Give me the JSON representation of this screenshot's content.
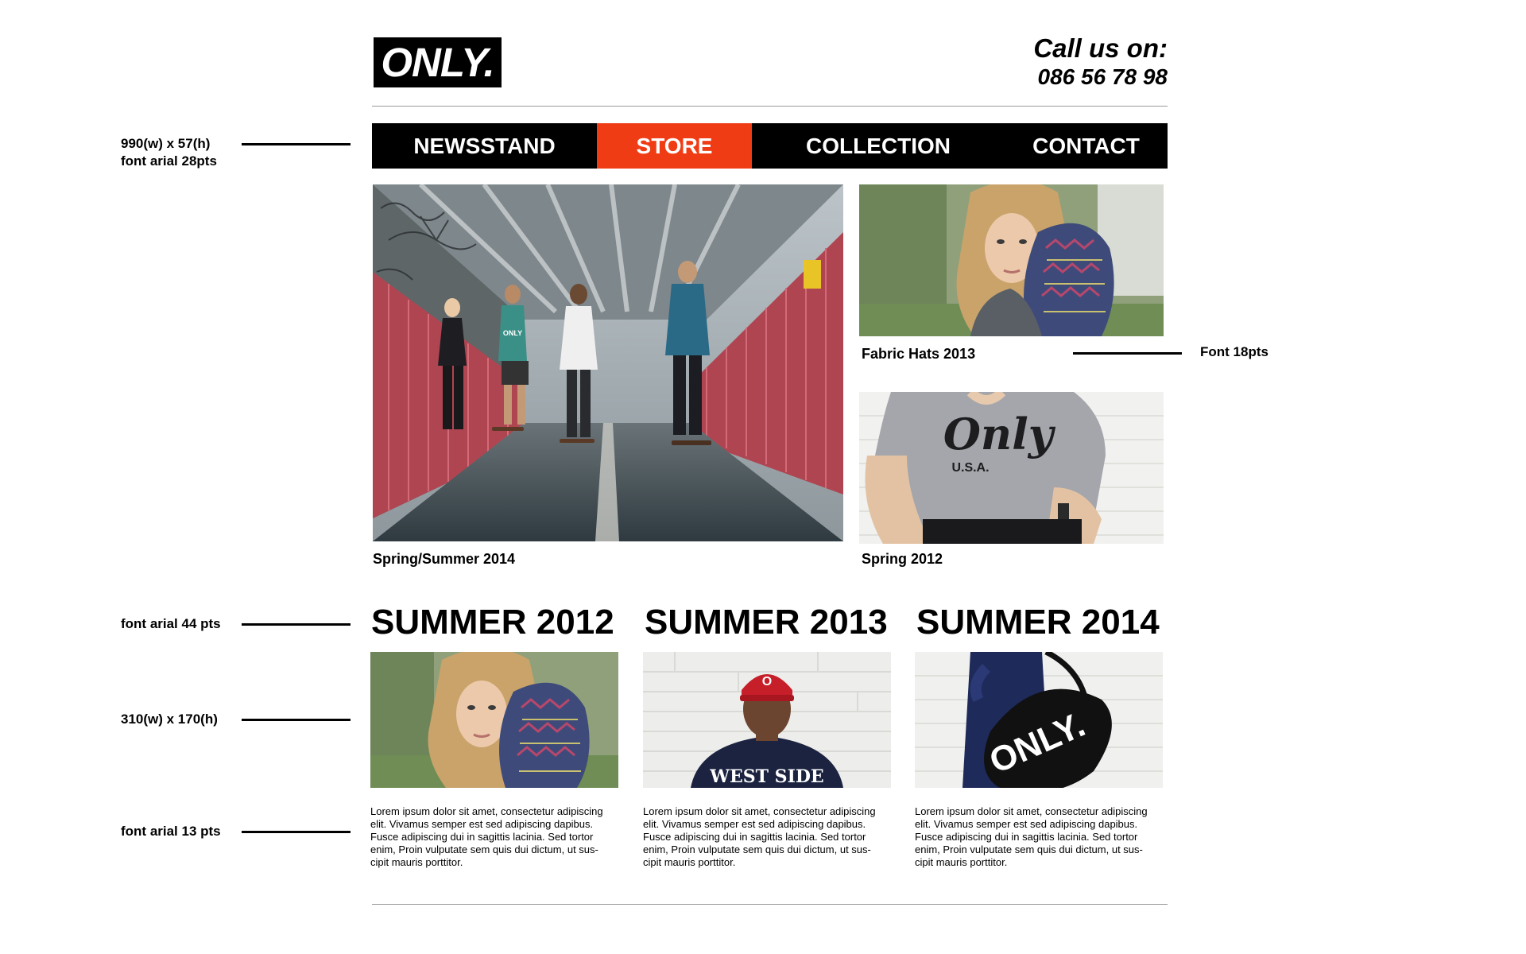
{
  "header": {
    "logo_text": "ONLY.",
    "call_label": "Call us on:",
    "phone_number": "086 56 78 98"
  },
  "nav": {
    "items": [
      {
        "label": "NEWSSTAND"
      },
      {
        "label": "STORE",
        "active": true
      },
      {
        "label": "COLLECTION"
      },
      {
        "label": "CONTACT"
      }
    ],
    "active_color": "#f03c15",
    "background_color": "#000000"
  },
  "featured": {
    "main": {
      "caption": "Spring/Summer 2014",
      "image": "skateboarders-on-bridge"
    },
    "side": [
      {
        "caption": "Fabric Hats 2013",
        "image": "woman-with-patterned-hat"
      },
      {
        "caption": "Spring 2012",
        "image": "man-in-grey-only-usa-tshirt"
      }
    ]
  },
  "collections": [
    {
      "title": "SUMMER 2012",
      "image": "woman-with-patterned-hat",
      "text": "Lorem ipsum dolor sit amet, consectetur adipiscing elit. Vivamus semper est sed adipiscing dapibus. Fusce adipiscing dui in sagittis lacinia. Sed tortor enim,  Proin vulputate sem quis dui dictum, ut sus-cipit mauris porttitor."
    },
    {
      "title": "SUMMER 2013",
      "image": "man-in-red-cap-west-side-sweater",
      "text": "Lorem ipsum dolor sit amet, consectetur adipiscing elit. Vivamus semper est sed adipiscing dapibus. Fusce adipiscing dui in sagittis lacinia. Sed tortor enim,  Proin vulputate sem quis dui dictum, ut sus-cipit mauris porttitor."
    },
    {
      "title": "SUMMER 2014",
      "image": "black-only-duffel-bag",
      "text": "Lorem ipsum dolor sit amet, consectetur adipiscing elit. Vivamus semper est sed adipiscing dapibus. Fusce adipiscing dui in sagittis lacinia. Sed tortor enim,  Proin vulputate sem quis dui dictum, ut sus-cipit mauris porttitor."
    }
  ],
  "annotations": {
    "nav": [
      "990(w) x 57(h)",
      "font arial 28pts"
    ],
    "caption": "Font 18pts",
    "title": "font arial 44 pts",
    "thumb": "310(w) x 170(h)",
    "body": "font arial 13 pts"
  },
  "image_text": {
    "tank_top": "ONLY",
    "tshirt_script": "Only",
    "tshirt_sub": "U.S.A.",
    "cap_letter": "O",
    "sweater": "WEST SIDE",
    "bag": "ONLY."
  }
}
